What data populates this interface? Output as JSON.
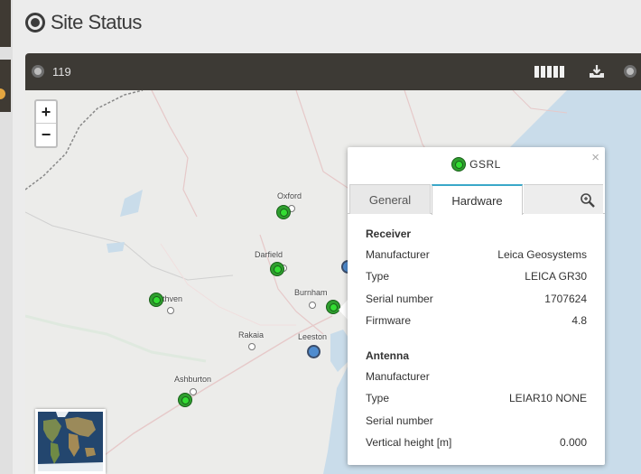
{
  "page": {
    "title": "Site Status"
  },
  "toolbar": {
    "site_count": "119"
  },
  "map": {
    "zoom_in": "+",
    "zoom_out": "−",
    "places": {
      "oxford": "Oxford",
      "darfield": "Darfield",
      "methven": "ethven",
      "burnham": "Burnham",
      "rakaia": "Rakaia",
      "leeston": "Leeston",
      "ashburton": "Ashburton"
    }
  },
  "popup": {
    "site": "GSRL",
    "close": "×",
    "tabs": {
      "general": "General",
      "hardware": "Hardware"
    },
    "receiver": {
      "heading": "Receiver",
      "manufacturer_label": "Manufacturer",
      "manufacturer": "Leica Geosystems",
      "type_label": "Type",
      "type": "LEICA GR30",
      "serial_label": "Serial number",
      "serial": "1707624",
      "firmware_label": "Firmware",
      "firmware": "4.8"
    },
    "antenna": {
      "heading": "Antenna",
      "manufacturer_label": "Manufacturer",
      "manufacturer": "",
      "type_label": "Type",
      "type": "LEIAR10 NONE",
      "serial_label": "Serial number",
      "serial": "",
      "height_label": "Vertical height [m]",
      "height": "0.000"
    }
  },
  "colors": {
    "toolbar_bg": "#3d3a35",
    "marker_active": "#2e9e2e",
    "marker_other": "#4f8ccf",
    "tab_accent": "#3aa8c9",
    "sea": "#c9dcea"
  },
  "icons": [
    "site-status-icon",
    "site-count-icon",
    "column-toggle-icon",
    "download-icon",
    "settings-icon",
    "magnifier-icon",
    "close-icon"
  ]
}
